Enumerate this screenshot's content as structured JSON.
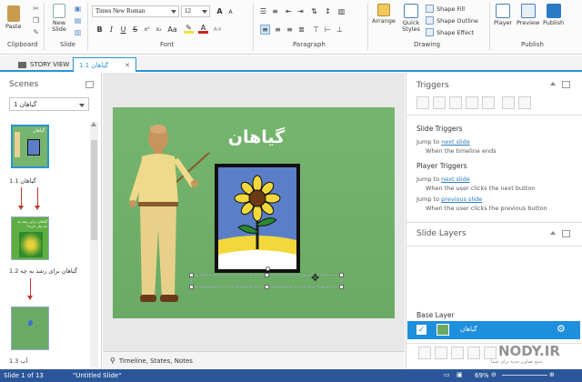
{
  "ribbon": {
    "clipboard": {
      "paste": "Paste",
      "label": "Clipboard"
    },
    "slide": {
      "new_slide": "New Slide",
      "label": "Slide"
    },
    "font": {
      "family": "Times New Roman",
      "size": "12",
      "label": "Font",
      "bold": "B",
      "italic": "I",
      "underline": "U"
    },
    "paragraph": {
      "label": "Paragraph"
    },
    "drawing": {
      "arrange": "Arrange",
      "quick_styles": "Quick Styles",
      "shape_fill": "Shape Fill",
      "shape_outline": "Shape Outline",
      "shape_effect": "Shape Effect",
      "label": "Drawing"
    },
    "publish": {
      "player": "Player",
      "preview": "Preview",
      "publish": "Publish",
      "label": "Publish"
    }
  },
  "tabs": {
    "story_view": "STORY VIEW",
    "active": "1.1 گیاهان"
  },
  "scenes": {
    "title": "Scenes",
    "selected": "1 گیاهان",
    "items": [
      {
        "caption": "1.1 گیاهان"
      },
      {
        "caption": "1.2 گیاهان برای رشد به چه",
        "thumb_text": "گیاهان برای رشد به چه نیاز دارند؟"
      },
      {
        "caption": "1.3 آب"
      }
    ]
  },
  "slide": {
    "title": "گیاهان"
  },
  "bottom_tab": {
    "label": "Timeline, States, Notes"
  },
  "triggers": {
    "title": "Triggers",
    "slide_triggers": "Slide Triggers",
    "t1_jump": "Jump to",
    "t1_link": "next slide",
    "t1_when": "When the timeline ends",
    "player_triggers": "Player Triggers",
    "t2_jump": "Jump to",
    "t2_link": "next slide",
    "t2_when": "When the user clicks the next button",
    "t3_jump": "Jump to",
    "t3_link": "previous slide",
    "t3_when": "When the user clicks the previous button"
  },
  "layers": {
    "title": "Slide Layers",
    "base": "Base Layer",
    "layer_name": "گیاهان"
  },
  "status": {
    "slide": "Slide 1 of 13",
    "name": "\"Untitled Slide\"",
    "zoom": "69%"
  },
  "watermark": {
    "brand": "NODY.IR",
    "sub": "منبع تصاویر جدید برای شما"
  },
  "colors": {
    "accent": "#2b93d6",
    "status_bar": "#2b579a",
    "slide_green": "#6aaa64",
    "layer_selected": "#1e8fdc"
  }
}
